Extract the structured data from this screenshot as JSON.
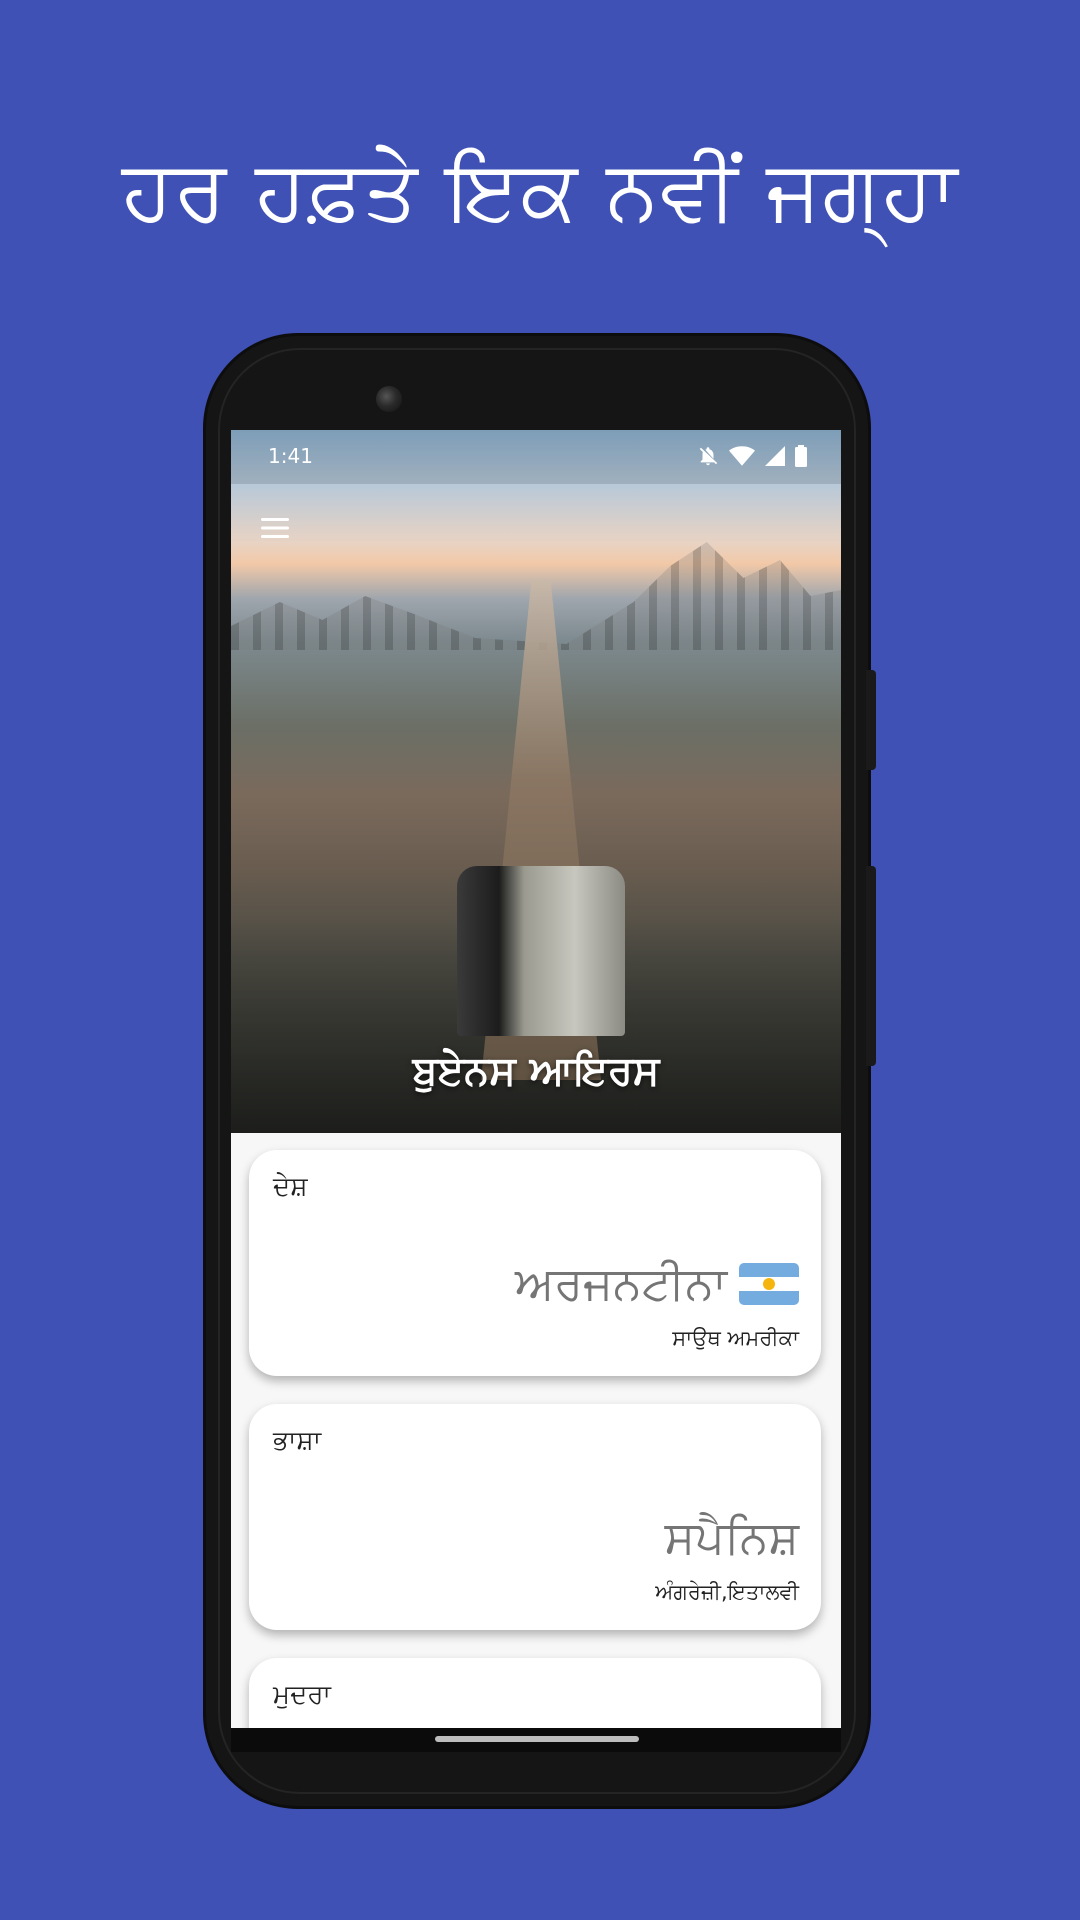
{
  "headline": "ਹਰ ਹਫ਼ਤੇ ਇਕ ਨਵੀਂ ਜਗ੍ਹਾ",
  "status_bar": {
    "time": "1:41",
    "icons": [
      "notifications-off-icon",
      "wifi-icon",
      "signal-icon",
      "battery-icon"
    ]
  },
  "hero": {
    "menu_icon": "hamburger-menu-icon",
    "city": "ਬੁਏਨਸ ਆਇਰਸ"
  },
  "cards": {
    "country": {
      "label": "ਦੇਸ਼",
      "value": "ਅਰਜਨਟੀਨਾ",
      "flag_icon": "argentina-flag-icon",
      "sub": "ਸਾਉਥ ਅਮਰੀਕਾ"
    },
    "language": {
      "label": "ਭਾਸ਼ਾ",
      "value": "ਸਪੈਨਿਸ਼",
      "sub": "ਅੰਗਰੇਜ਼ੀ,ਇਤਾਲਵੀ"
    },
    "currency": {
      "label": "ਮੁਦਰਾ"
    }
  },
  "colors": {
    "background": "#3f51b5",
    "card": "#ffffff",
    "value_text": "#757575"
  }
}
